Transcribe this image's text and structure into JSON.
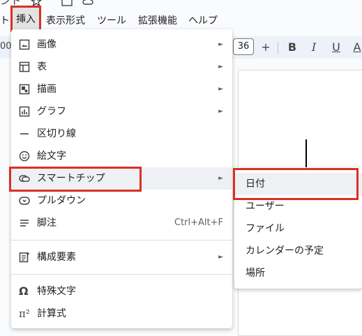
{
  "top_strip": {
    "fragment": "ント"
  },
  "menubar": {
    "items": [
      {
        "label": "ト"
      },
      {
        "label": "挿入"
      },
      {
        "label": "表示形式"
      },
      {
        "label": "ツール"
      },
      {
        "label": "拡張機能"
      },
      {
        "label": "ヘルプ"
      }
    ]
  },
  "toolbar": {
    "zoom_fragment": "00",
    "font_size": "36",
    "plus": "+",
    "bold": "B",
    "italic": "I",
    "underline": "U",
    "text_color": "A"
  },
  "insert_menu": {
    "items": [
      {
        "label": "画像",
        "icon": "image-icon",
        "submenu": true
      },
      {
        "label": "表",
        "icon": "table-icon",
        "submenu": true
      },
      {
        "label": "描画",
        "icon": "drawing-icon",
        "submenu": true
      },
      {
        "label": "グラフ",
        "icon": "chart-icon",
        "submenu": true
      },
      {
        "label": "区切り線",
        "icon": "horizontal-line-icon",
        "submenu": false
      },
      {
        "label": "絵文字",
        "icon": "emoji-icon",
        "submenu": false
      },
      {
        "label": "スマートチップ",
        "icon": "smart-chip-icon",
        "submenu": true
      },
      {
        "label": "プルダウン",
        "icon": "dropdown-icon",
        "submenu": false
      },
      {
        "label": "脚注",
        "icon": "footnote-icon",
        "submenu": false,
        "shortcut": "Ctrl+Alt+F"
      },
      {
        "label": "構成要素",
        "icon": "building-blocks-icon",
        "submenu": true
      },
      {
        "label": "特殊文字",
        "icon": "omega-icon",
        "submenu": false
      },
      {
        "label": "計算式",
        "icon": "equation-icon",
        "submenu": false
      }
    ]
  },
  "smart_chip_submenu": {
    "items": [
      {
        "label": "日付"
      },
      {
        "label": "ユーザー"
      },
      {
        "label": "ファイル"
      },
      {
        "label": "カレンダーの予定"
      },
      {
        "label": "場所"
      }
    ]
  },
  "colors": {
    "highlight_border": "#d93025",
    "menu_hover": "#eef0f3"
  }
}
